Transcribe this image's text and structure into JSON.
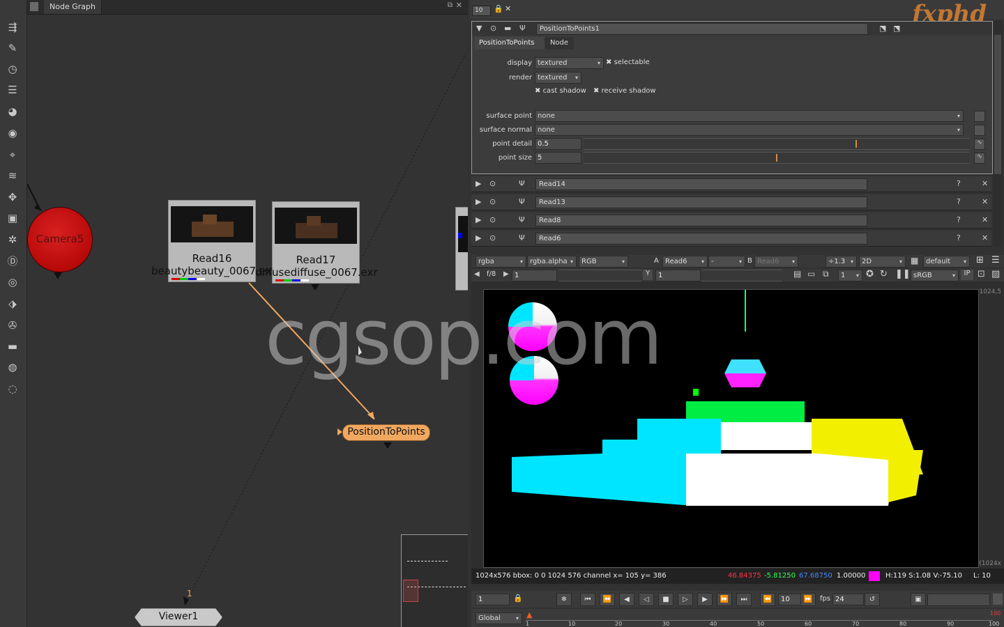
{
  "node_graph": {
    "tab_label": "Node Graph",
    "nodes": {
      "camera": "Camera5",
      "read16_title": "Read16",
      "read16_file": "beautybeauty_0067.exr",
      "read17_title": "Read17",
      "read17_file": "diffusediffuse_0067.exr",
      "position_to_points": "PositionToPoints",
      "viewer": "Viewer1",
      "viewer_input_number": "1"
    }
  },
  "properties": {
    "max_panels": "10",
    "node_name": "PositionToPoints1",
    "tabs": [
      "PositionToPoints",
      "Node"
    ],
    "display_label": "display",
    "display_value": "textured",
    "selectable_label": "selectable",
    "render_label": "render",
    "render_value": "textured",
    "cast_shadow_label": "cast shadow",
    "receive_shadow_label": "receive shadow",
    "surface_point_label": "surface point",
    "surface_point_value": "none",
    "surface_normal_label": "surface normal",
    "surface_normal_value": "none",
    "point_detail_label": "point detail",
    "point_detail_value": "0.5",
    "point_size_label": "point size",
    "point_size_value": "5",
    "collapsed_nodes": [
      "Read14",
      "Read13",
      "Read8",
      "Read6"
    ]
  },
  "viewer_controls": {
    "channels": "rgba",
    "alpha": "rgba.alpha",
    "colorspace_channels": "RGB",
    "a_label": "A",
    "a_input": "Read6",
    "b_label": "B",
    "b_input": "Read6",
    "zoom": "÷1.3",
    "view_mode": "2D",
    "lut": "default",
    "fstop": "f/8",
    "gain": "1",
    "gamma_label": "Y",
    "gamma": "1",
    "frame_step": "1",
    "display_lut": "sRGB",
    "ip_label": "IP",
    "resolution_corner": "1024,5",
    "resolution_corner2": "(1024x"
  },
  "status_bar": {
    "info": "1024x576 bbox: 0 0 1024 576 channel  x= 105 y= 386",
    "r": "46.84375",
    "g": "-5.81250",
    "b": "67.68750",
    "a": "1.00000",
    "swatch_color": "#ff00ff",
    "hsv": "H:119 S:1.08 V:-75.10",
    "l": "L: 10"
  },
  "timeline": {
    "current_frame": "1",
    "skip_frames": "10",
    "fps_label": "fps",
    "fps": "24",
    "range_mode": "Global",
    "ticks": [
      "1",
      "10",
      "20",
      "30",
      "40",
      "50",
      "60",
      "70",
      "80",
      "90",
      "100"
    ],
    "end_marker": "100"
  },
  "overlays": {
    "watermark": "cgsop.com",
    "logo": "fxphd"
  }
}
